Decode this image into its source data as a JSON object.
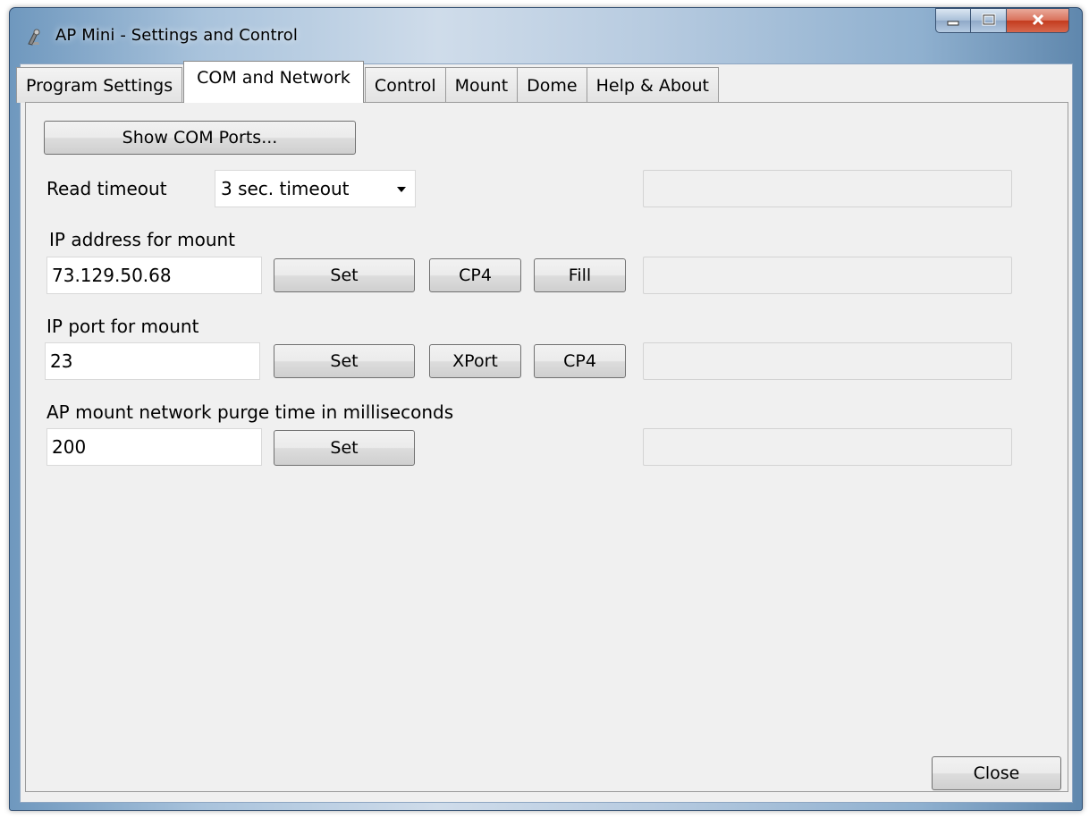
{
  "window": {
    "title": "AP Mini - Settings and Control",
    "icon": "telescope-app-icon"
  },
  "caption_buttons": {
    "minimize": "minimize-icon",
    "maximize": "maximize-icon",
    "close": "close-icon"
  },
  "tabs": [
    {
      "label": "Program Settings",
      "active": false
    },
    {
      "label": "COM and Network",
      "active": true
    },
    {
      "label": "Control",
      "active": false
    },
    {
      "label": "Mount",
      "active": false
    },
    {
      "label": "Dome",
      "active": false
    },
    {
      "label": "Help & About",
      "active": false
    }
  ],
  "com": {
    "show_ports_label": "Show COM Ports...",
    "read_timeout_label": "Read timeout",
    "read_timeout_value": "3 sec. timeout"
  },
  "ip_address": {
    "label": "IP address for mount",
    "value": "73.129.50.68",
    "set_label": "Set",
    "cp4_label": "CP4",
    "fill_label": "Fill"
  },
  "ip_port": {
    "label": "IP port for mount",
    "value": "23",
    "set_label": "Set",
    "xport_label": "XPort",
    "cp4_label": "CP4"
  },
  "purge": {
    "label": "AP mount network purge time in milliseconds",
    "value": "200",
    "set_label": "Set"
  },
  "footer": {
    "close_label": "Close"
  }
}
